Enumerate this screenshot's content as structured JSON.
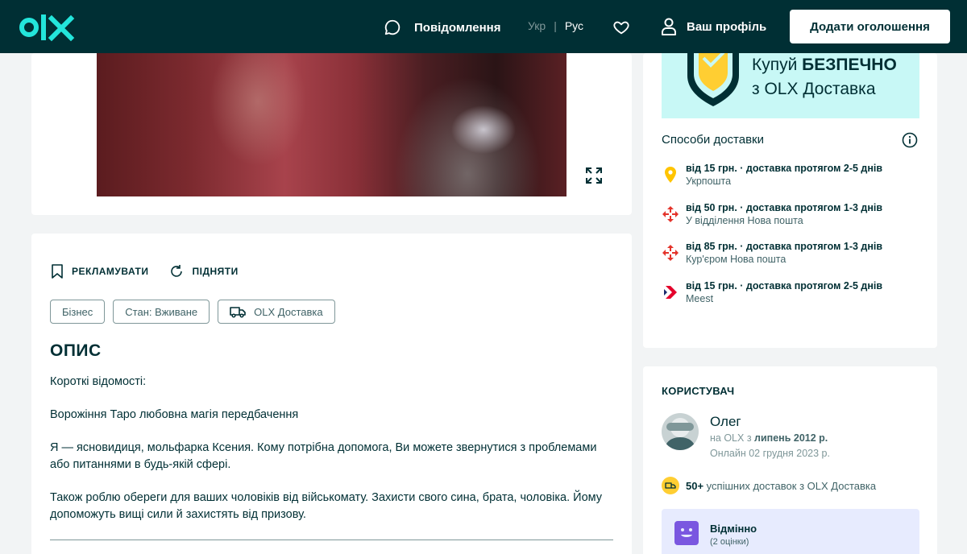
{
  "header": {
    "messages_label": "Повідомлення",
    "lang_ukr": "Укр",
    "lang_separator": "|",
    "lang_rus": "Рус",
    "profile_label": "Ваш профіль",
    "add_button_label": "Додати оголошення"
  },
  "listing": {
    "actions": [
      {
        "label": "РЕКЛАМУВАТИ",
        "icon": "bookmark-icon"
      },
      {
        "label": "ПІДНЯТИ",
        "icon": "refresh-icon"
      }
    ],
    "tags": [
      {
        "label": "Бізнес"
      },
      {
        "label": "Стан: Вживане"
      },
      {
        "label": "OLX Доставка",
        "icon": "truck-icon"
      }
    ],
    "description_title": "ОПИС",
    "description": [
      "Короткі відомості:",
      "Ворожіння Таро любовна магія передбачення",
      "Я — ясновидиця, мольфарка Ксения. Кому потрібна допомога, Ви можете звернутися з проблемами або питаннями в будь-якій сфері.",
      "Також роблю обереги для ваших чоловіків від військомату. Захисти свого сина, брата, чоловіка. Йому допоможуть вищі сили й захистять від призову."
    ]
  },
  "delivery": {
    "banner_line1": "Купуй ",
    "banner_line1_bold": "БЕЗПЕЧНО",
    "banner_line2": "з OLX Доставка",
    "title": "Способи доставки",
    "items": [
      {
        "main": "від 15 грн. · доставка протягом 2-5 днів",
        "sub": "Укрпошта",
        "icon": "ukrposhta-icon"
      },
      {
        "main": "від 50 грн. · доставка протягом 1-3 днів",
        "sub": "У відділення Нова пошта",
        "icon": "nova-poshta-icon"
      },
      {
        "main": "від 85 грн. · доставка протягом 1-3 днів",
        "sub": "Кур'єром Нова пошта",
        "icon": "nova-poshta-icon"
      },
      {
        "main": "від 15 грн. · доставка протягом 2-5 днів",
        "sub": "Meest",
        "icon": "meest-icon"
      }
    ]
  },
  "user": {
    "section_title": "КОРИСТУВАЧ",
    "name": "Олег",
    "since_prefix": "на OLX з ",
    "since_date": "липень 2012 р.",
    "online": "Онлайн 02 грудня 2023 р.",
    "deliveries_count": "50+",
    "deliveries_text": " успішних доставок з OLX Доставка",
    "rating_label": "Відмінно",
    "rating_sub": "(2 оцінки)"
  },
  "colors": {
    "header_bg": "#002f34",
    "logo_teal": "#23e5db",
    "rating_bg": "#e7ebfe",
    "banner_bg": "#c8f8f6"
  }
}
